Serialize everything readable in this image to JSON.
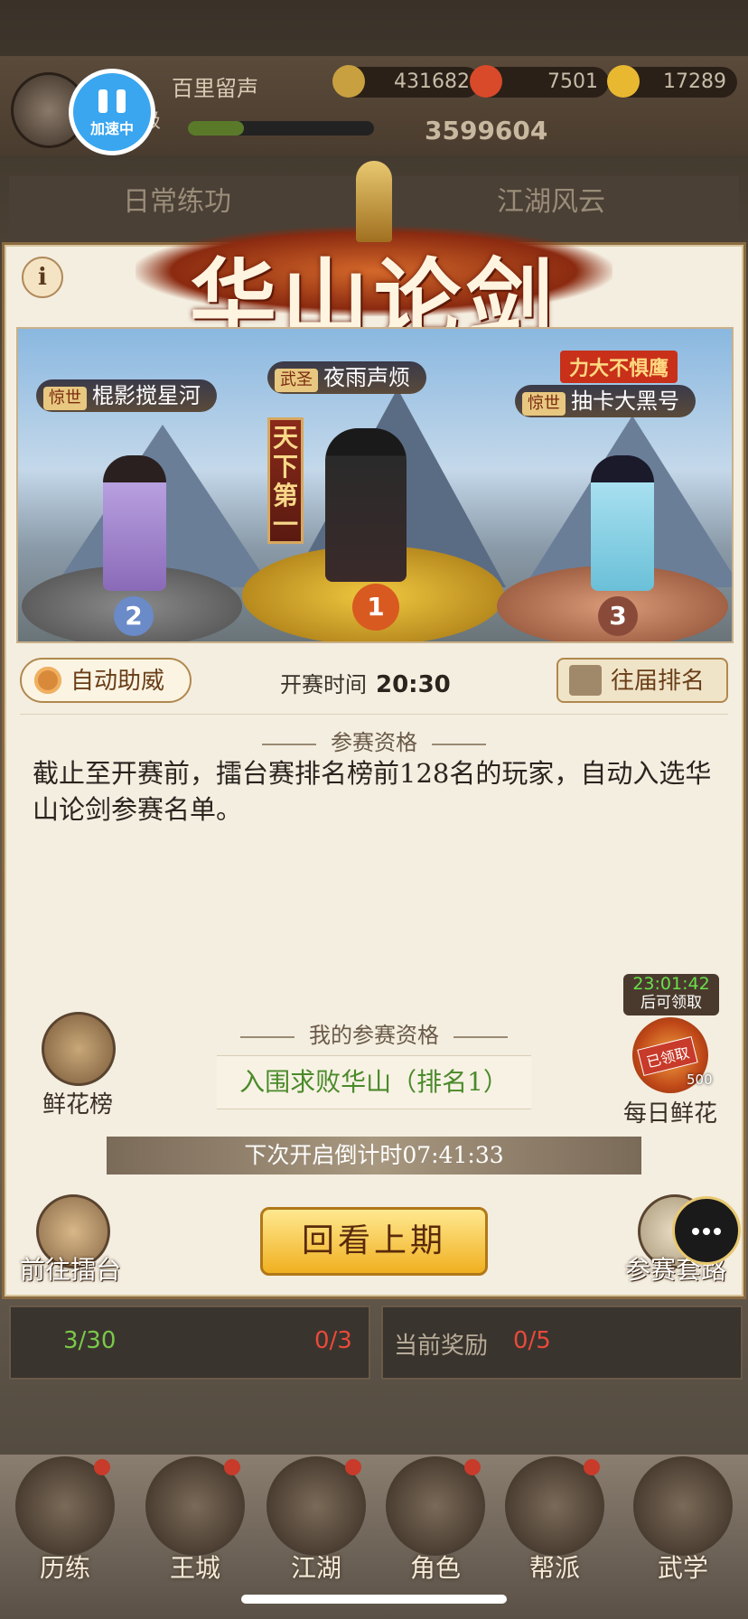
{
  "header": {
    "player_name": "百里留声",
    "level_suffix": "级",
    "level_progress": 0.3,
    "resources": [
      {
        "icon": "copper-coin-icon",
        "value": "431682"
      },
      {
        "icon": "ember-icon",
        "value": "7501"
      },
      {
        "icon": "gold-ingot-icon",
        "value": "17289"
      }
    ],
    "power": "3599604",
    "accelerate_label": "加速中"
  },
  "tabs": {
    "daily": "日常练功",
    "jianghu": "江湖风云"
  },
  "modal": {
    "title": "华山论剑",
    "info_icon": "i",
    "podium": {
      "first": {
        "badge": "武圣",
        "name": "夜雨声烦",
        "rank": "1"
      },
      "second": {
        "badge": "惊世",
        "name": "棍影搅星河",
        "rank": "2"
      },
      "third": {
        "badge": "惊世",
        "name": "抽卡大黑号",
        "rank": "3"
      },
      "banner": "天下第一",
      "third_tag": "力大不惧鹰"
    },
    "auto_cheer": "自动助威",
    "start_time_label": "开赛时间",
    "start_time": "20:30",
    "past_rankings": "往届排名",
    "qualification_title": "参赛资格",
    "qualification_desc": "截止至开赛前，擂台赛排名榜前128名的玩家，自动入选华山论剑参赛名单。",
    "my_qualification_title": "我的参赛资格",
    "my_qualification": "入围求败华山（排名1）",
    "flower_rank": "鲜花榜",
    "flower_timer": "23:01:42",
    "flower_timer_note": "后可领取",
    "flower_stamp": "已领取",
    "flower_count": "500",
    "daily_flower": "每日鲜花",
    "countdown": "下次开启倒计时07:41:33",
    "review_button": "回看上期",
    "go_arena": "前往擂台",
    "tactics": "参赛套路"
  },
  "under_modal": {
    "energy": "3/30",
    "attempts": "0/3",
    "reward_label": "当前奖励",
    "reward": "0/5"
  },
  "nav": [
    {
      "label": "历练"
    },
    {
      "label": "王城"
    },
    {
      "label": "江湖"
    },
    {
      "label": "角色"
    },
    {
      "label": "帮派"
    },
    {
      "label": "武学"
    }
  ],
  "colors": {
    "accent": "#f0b020",
    "accelerate": "#3aa6f0",
    "qualified_text": "#4a8a2a"
  }
}
